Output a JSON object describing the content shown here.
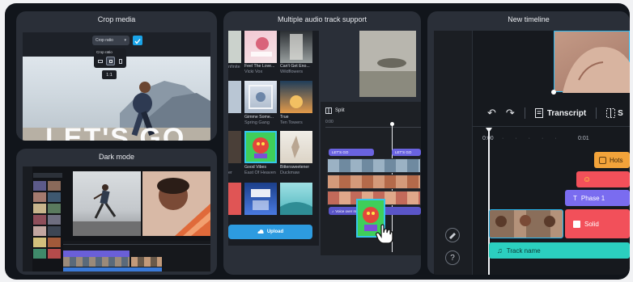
{
  "colors": {
    "accent": "#1aa4e8",
    "teal": "#2bcfbf",
    "purple": "#7a6cf0",
    "orange": "#f2a33a",
    "red": "#f2505a",
    "upload": "#2d9be0"
  },
  "panels": {
    "crop": {
      "title": "Crop media",
      "dropdown_label": "Crop ratio",
      "popup_label": "Crop ratio",
      "tooltip": "1:1",
      "big_text": "LET'S GO"
    },
    "dark": {
      "title": "Dark mode"
    },
    "audio": {
      "title": "Multiple audio track support",
      "albums": [
        {
          "title": "",
          "artist": "nfinite"
        },
        {
          "title": "Feel The Love...",
          "artist": "Vicki Vox"
        },
        {
          "title": "Can't Get Eno...",
          "artist": "Wildflowers"
        },
        {
          "title": "",
          "artist": ""
        },
        {
          "title": "Gimme Some...",
          "artist": "Spring Gang"
        },
        {
          "title": "True",
          "artist": "Ten Towers"
        },
        {
          "title": "er",
          "artist": "East Of Heaven"
        },
        {
          "title": "Good Vibes",
          "artist": "East Of Heaven"
        },
        {
          "title": "Bittersweetener",
          "artist": "Duckmaw"
        }
      ],
      "upload_label": "Upload",
      "split_label": "Split",
      "time_label": "0:00",
      "clip_label_1": "LET'S GO",
      "clip_label_2": "LET'S GO",
      "audio_clip_label": "Voice over m..."
    },
    "timeline": {
      "title": "New timeline",
      "transcript_label": "Transcript",
      "next_label": "S",
      "time_start": "0:00",
      "time_next": "0:01",
      "tracks": {
        "hots": "Hots",
        "emoji": "☺",
        "phase": "Phase 1",
        "solid": "Solid",
        "track_name": "Track name"
      }
    }
  }
}
